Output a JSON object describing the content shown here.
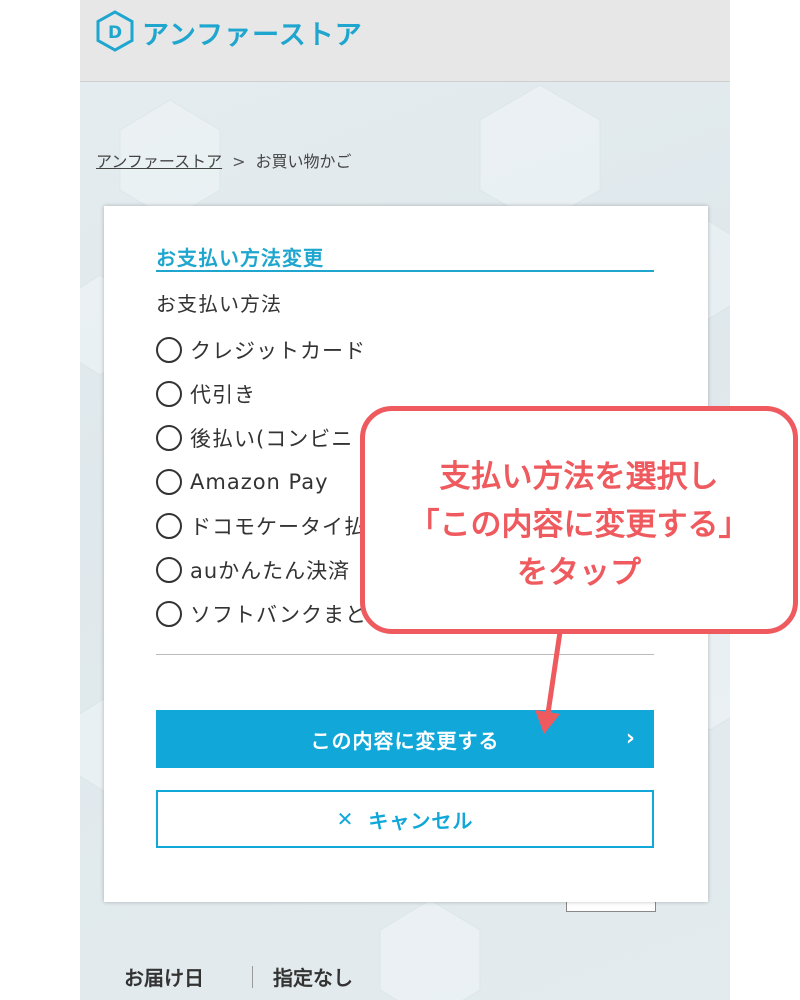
{
  "header": {
    "brand": "アンファーストア"
  },
  "breadcrumb": {
    "home": "アンファーストア",
    "separator": ">",
    "current": "お買い物かご"
  },
  "modal": {
    "title": "お支払い方法変更",
    "label": "お支払い方法",
    "options": [
      "クレジットカード",
      "代引き",
      "後払い(コンビニ・銀行・郵便局)",
      "Amazon Pay",
      "ドコモケータイ払い",
      "auかんたん決済",
      "ソフトバンクまとめて支払い"
    ],
    "confirm_button": "この内容に変更する",
    "cancel_button": "キャンセル"
  },
  "callout": {
    "line1": "支払い方法を選択し",
    "line2": "「この内容に変更する」",
    "line3": "をタップ"
  },
  "delivery": {
    "label": "お届け日",
    "value": "指定なし"
  },
  "colors": {
    "accent": "#11a8d9",
    "brand": "#1ea6cf",
    "callout": "#ee5a5e"
  },
  "icons": {
    "logo": "brand-logo-icon",
    "chevron": "chevron-right-icon",
    "close": "close-icon",
    "arrow": "arrow-down-icon"
  }
}
